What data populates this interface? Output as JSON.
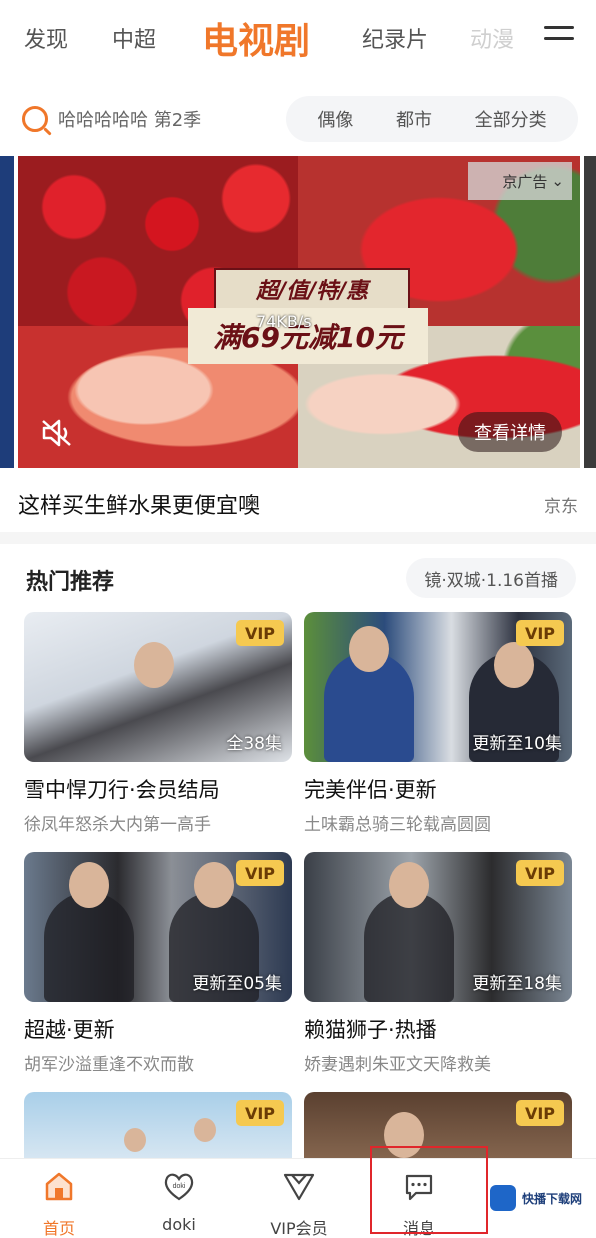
{
  "top_tabs": {
    "items": [
      "发现",
      "中超",
      "电视剧",
      "纪录片",
      "动漫"
    ],
    "active": "电视剧"
  },
  "search": {
    "text": "哈哈哈哈哈 第2季",
    "chips": [
      "偶像",
      "都市",
      "全部分类"
    ]
  },
  "banner": {
    "ad_tag": "京广告",
    "promo_line1": "超/值/特/惠",
    "promo_line2": "满69元减10元",
    "speed": "74KB/s",
    "details_button": "查看详情",
    "title": "这样买生鲜水果更便宜噢",
    "source": "京东"
  },
  "section": {
    "title": "热门推荐",
    "chip": "镜·双城·1.16首播"
  },
  "cards": [
    {
      "badge": "VIP",
      "episodes": "全38集",
      "title": "雪中悍刀行·会员结局",
      "subtitle": "徐凤年怒杀大内第一高手"
    },
    {
      "badge": "VIP",
      "episodes": "更新至10集",
      "title": "完美伴侣·更新",
      "subtitle": "土味霸总骑三轮载高圆圆"
    },
    {
      "badge": "VIP",
      "episodes": "更新至05集",
      "title": "超越·更新",
      "subtitle": "胡军沙溢重逢不欢而散"
    },
    {
      "badge": "VIP",
      "episodes": "更新至18集",
      "title": "赖猫狮子·热播",
      "subtitle": "娇妻遇刺朱亚文天降救美"
    },
    {
      "badge": "VIP",
      "episodes": "",
      "title": "",
      "subtitle": ""
    },
    {
      "badge": "VIP",
      "episodes": "",
      "title": "",
      "subtitle": ""
    }
  ],
  "bottom_nav": {
    "items": [
      {
        "label": "首页",
        "icon": "home-icon"
      },
      {
        "label": "doki",
        "icon": "doki-heart-icon"
      },
      {
        "label": "VIP会员",
        "icon": "vip-icon"
      },
      {
        "label": "消息",
        "icon": "message-icon"
      }
    ],
    "active": "首页",
    "doki_icon_text": "doki"
  },
  "watermark": {
    "text": "快播下载网"
  },
  "colors": {
    "accent": "#f0772a",
    "vip": "#f5c950",
    "highlight": "#e0262b"
  }
}
